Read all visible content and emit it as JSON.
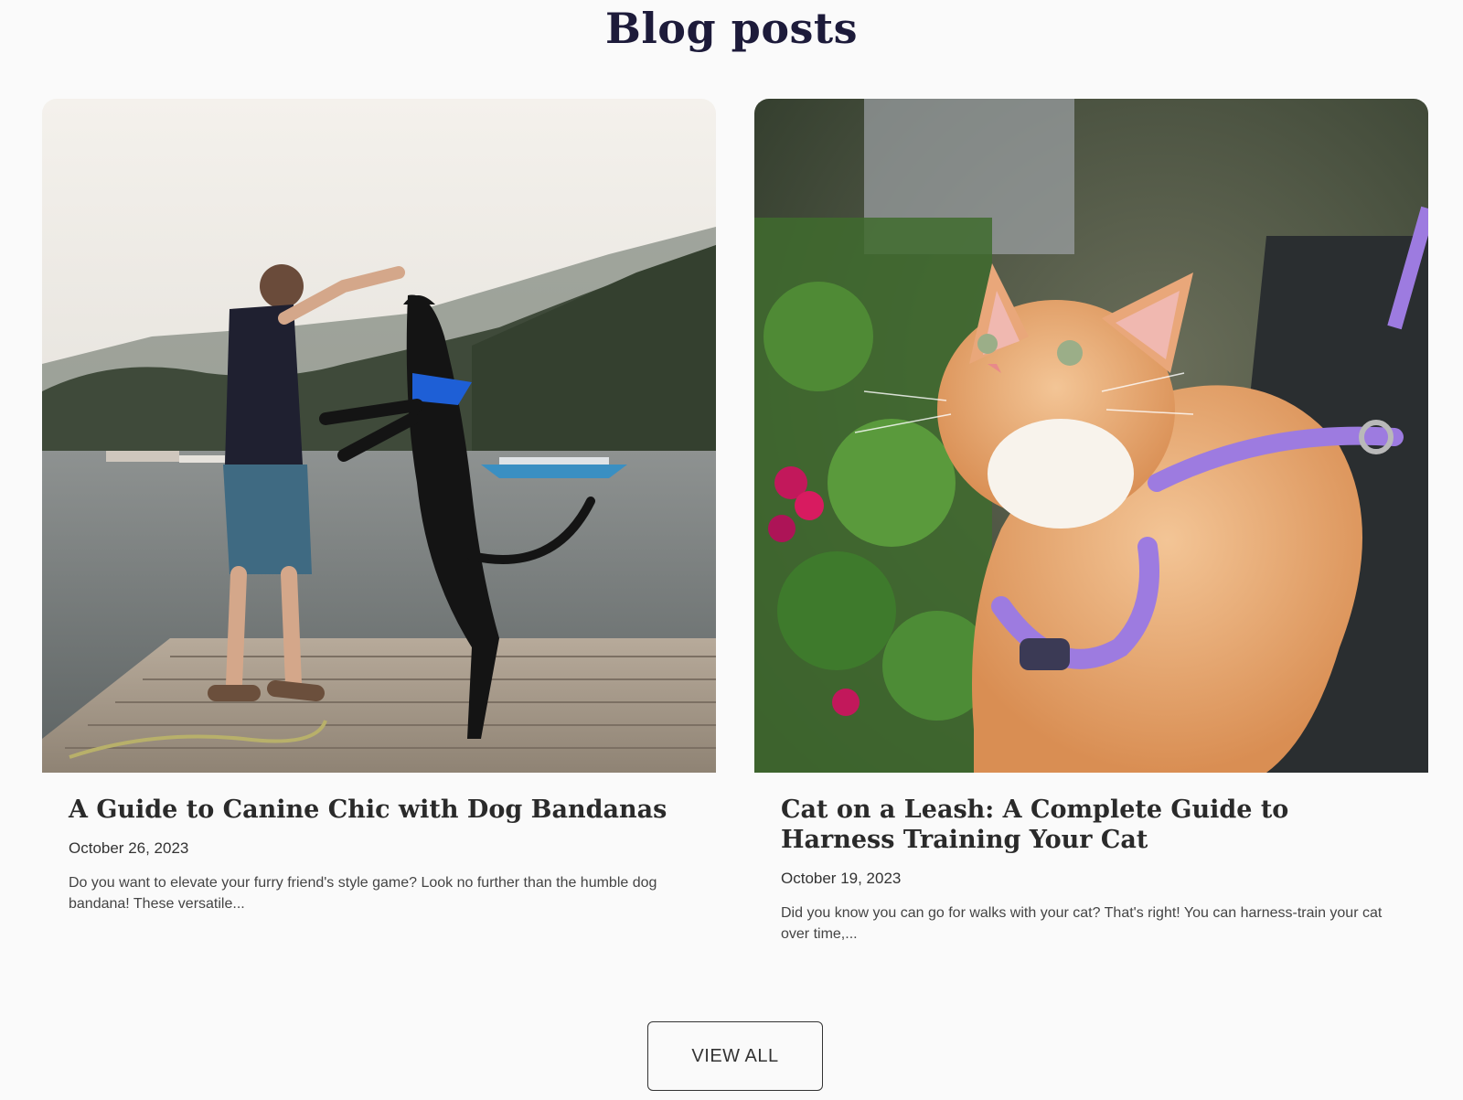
{
  "section": {
    "title": "Blog posts"
  },
  "posts": [
    {
      "title": "A Guide to Canine Chic with Dog Bandanas",
      "date": "October 26, 2023",
      "excerpt": "Do you want to elevate your furry friend's style game? Look no further than the humble dog bandana! These versatile...",
      "image_icon": "photo-dog-on-dock"
    },
    {
      "title": "Cat on a Leash: A Complete Guide to Harness Training Your Cat",
      "date": "October 19, 2023",
      "excerpt": "Did you know you can go for walks with your cat? That's right! You can harness-train your cat over time,...",
      "image_icon": "photo-cat-in-harness"
    }
  ],
  "view_all": {
    "label": "VIEW ALL"
  },
  "colors": {
    "title": "#1d1b3a",
    "background": "#fafafa",
    "text": "#2a2a2a",
    "harness": "#9d7be0",
    "bandana": "#1e5fd6"
  }
}
